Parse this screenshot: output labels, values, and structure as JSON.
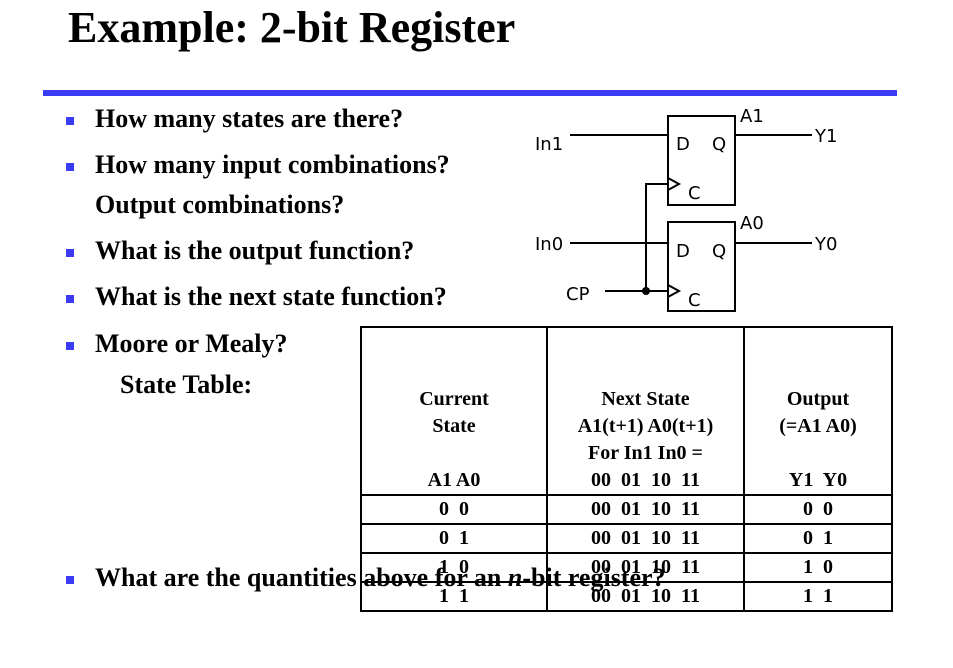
{
  "title": "Example: 2-bit Register",
  "bullets": [
    "How many states are there?",
    "How many input combinations?",
    "Output combinations?",
    "What is the output function?",
    "What is the next state function?",
    "Moore or Mealy?",
    "State Table:",
    "What are the quantities above for an ",
    "n",
    "-bit register?"
  ],
  "circuit": {
    "in1": "In1",
    "in0": "In0",
    "cp": "CP",
    "a1": "A1",
    "a0": "A0",
    "y1": "Y1",
    "y0": "Y0",
    "d": "D",
    "q": "Q",
    "c": "C"
  },
  "table": {
    "headers": [
      [
        "Current",
        "State",
        "",
        "A1 A0"
      ],
      [
        "Next State",
        "A1(t+1) A0(t+1)",
        "For In1 In0 =",
        "00  01  10  11"
      ],
      [
        "Output",
        "(=A1 A0)",
        "",
        "Y1  Y0"
      ]
    ],
    "rows": [
      [
        "0  0",
        "00  01  10  11",
        "0  0"
      ],
      [
        "0  1",
        "00  01  10  11",
        "0  1"
      ],
      [
        "1  0",
        "00  01  10  11",
        "1  0"
      ],
      [
        "1  1",
        "00  01  10  11",
        "1  1"
      ]
    ]
  },
  "colors": {
    "accent": "#3b3bf5"
  }
}
